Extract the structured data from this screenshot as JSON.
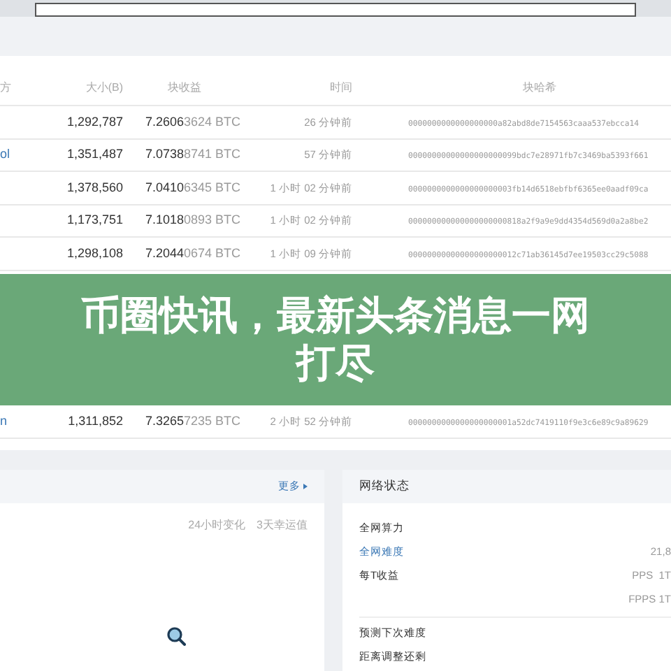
{
  "table": {
    "columns": [
      "方",
      "大小(B)",
      "块收益",
      "时间",
      "块哈希"
    ],
    "rows_above_banner": [
      {
        "size": "1,292,787",
        "reward_main": "7.2606",
        "reward_rest": "3624 BTC",
        "time": "26 分钟前",
        "hash": "0000000000000000000a82abd8de7154563caaa537ebcca14"
      },
      {
        "pool": "ol",
        "size": "1,351,487",
        "reward_main": "7.0738",
        "reward_rest": "8741 BTC",
        "time": "57 分钟前",
        "hash": "00000000000000000000099bdc7e28971fb7c3469ba5393f661"
      },
      {
        "size": "1,378,560",
        "reward_main": "7.0410",
        "reward_rest": "6345 BTC",
        "time": "1 小时 02 分钟前",
        "hash": "0000000000000000000003fb14d6518ebfbf6365ee0aadf09ca"
      },
      {
        "size": "1,173,751",
        "reward_main": "7.1018",
        "reward_rest": "0893 BTC",
        "time": "1 小时 02 分钟前",
        "hash": "000000000000000000000818a2f9a9e9dd4354d569d0a2a8be2"
      },
      {
        "size": "1,298,108",
        "reward_main": "7.2044",
        "reward_rest": "0674 BTC",
        "time": "1 小时 09 分钟前",
        "hash": "00000000000000000000012c71ab36145d7ee19503cc29c5088"
      }
    ],
    "rows_below_banner": [
      {
        "pool": "n",
        "size": "1,311,852",
        "reward_main": "7.3265",
        "reward_rest": "7235 BTC",
        "time": "2 小时 52 分钟前",
        "hash": "0000000000000000000001a52dc7419110f9e3c6e89c9a89629"
      }
    ]
  },
  "banner": {
    "lines": [
      "币圈快讯，最新头条消息一网",
      "打尽"
    ]
  },
  "left_panel": {
    "more_link": "更多",
    "tabs": [
      "24小时变化",
      "3天幸运值"
    ]
  },
  "network_panel": {
    "title": "网络状态",
    "rows": [
      {
        "kind": "label",
        "label": "全网算力"
      },
      {
        "kind": "link",
        "label": "全网难度",
        "value": "21,8"
      },
      {
        "kind": "label",
        "label": "每T收益",
        "value": "PPS  1T"
      },
      {
        "kind": "value",
        "value": "FPPS 1T"
      },
      {
        "kind": "divider"
      },
      {
        "kind": "label",
        "label": "预测下次难度"
      },
      {
        "kind": "label",
        "label": "距离调整还剩"
      }
    ]
  }
}
